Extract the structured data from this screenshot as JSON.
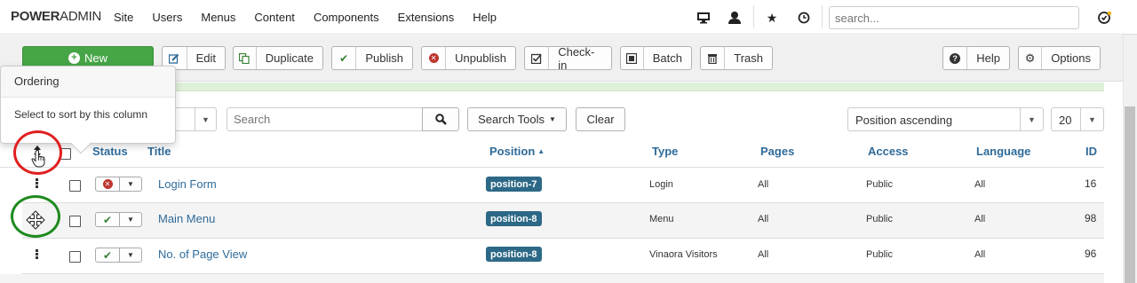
{
  "brand": {
    "bold": "POWER",
    "thin": "ADMIN"
  },
  "menu": [
    "Site",
    "Users",
    "Menus",
    "Content",
    "Components",
    "Extensions",
    "Help"
  ],
  "nav_search": {
    "placeholder": "search..."
  },
  "toolbar": {
    "new_label": "New",
    "edit_label": "Edit",
    "duplicate_label": "Duplicate",
    "publish_label": "Publish",
    "unpublish_label": "Unpublish",
    "checkin_label": "Check-in",
    "batch_label": "Batch",
    "trash_label": "Trash",
    "help_label": "Help",
    "options_label": "Options"
  },
  "tooltip": {
    "title": "Ordering",
    "body": "Select to sort by this column"
  },
  "filters": {
    "search_placeholder": "Search",
    "search_tools_label": "Search Tools",
    "clear_label": "Clear",
    "sort_value": "Position ascending",
    "limit_value": "20"
  },
  "table": {
    "headers": {
      "status": "Status",
      "title": "Title",
      "position": "Position",
      "type": "Type",
      "pages": "Pages",
      "access": "Access",
      "language": "Language",
      "id": "ID"
    },
    "rows": [
      {
        "title": "Login Form",
        "status": "unpublished",
        "position": "position-7",
        "type": "Login",
        "pages": "All",
        "access": "Public",
        "language": "All",
        "id": "16"
      },
      {
        "title": "Main Menu",
        "status": "published",
        "position": "position-8",
        "type": "Menu",
        "pages": "All",
        "access": "Public",
        "language": "All",
        "id": "98"
      },
      {
        "title": "No. of Page View",
        "status": "published",
        "position": "position-8",
        "type": "Vinaora Visitors",
        "pages": "All",
        "access": "Public",
        "language": "All",
        "id": "96"
      }
    ]
  },
  "colors": {
    "new_button": "#46a546",
    "link": "#2f6b9a",
    "position_badge": "#2d6987",
    "annotation_red": "#e02020",
    "annotation_green": "#1e8a1e"
  }
}
